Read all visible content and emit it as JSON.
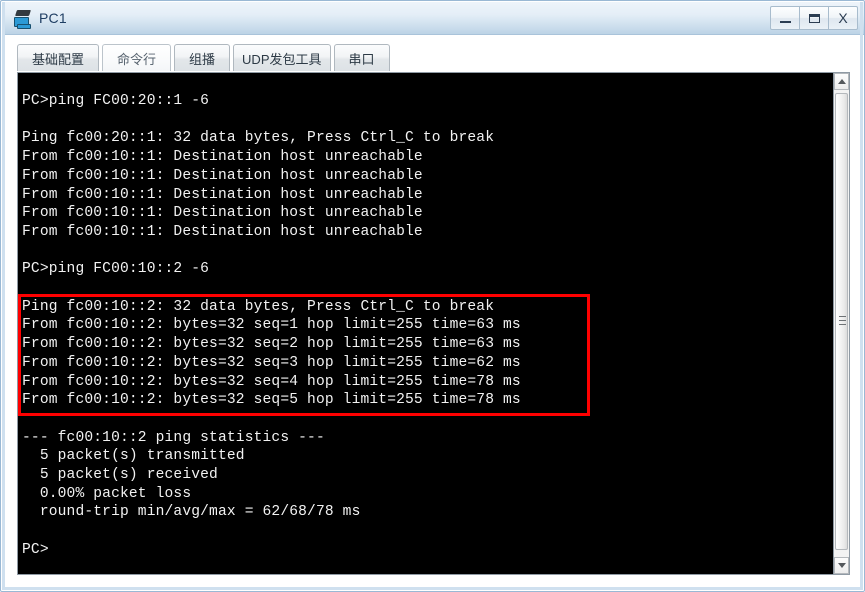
{
  "window": {
    "title": "PC1",
    "icon": "pc-device-icon",
    "buttons": {
      "minimize": "minimize-button",
      "maximize": "maximize-button",
      "close": "X"
    }
  },
  "tabs": [
    {
      "label": "基础配置",
      "active": false
    },
    {
      "label": "命令行",
      "active": true
    },
    {
      "label": "组播",
      "active": false
    },
    {
      "label": "UDP发包工具",
      "active": false
    },
    {
      "label": "串口",
      "active": false
    }
  ],
  "terminal": {
    "background_color": "#000000",
    "text_color": "#f2f2f2",
    "content": "PC>ping FC00:20::1 -6\n\nPing fc00:20::1: 32 data bytes, Press Ctrl_C to break\nFrom fc00:10::1: Destination host unreachable\nFrom fc00:10::1: Destination host unreachable\nFrom fc00:10::1: Destination host unreachable\nFrom fc00:10::1: Destination host unreachable\nFrom fc00:10::1: Destination host unreachable\n\nPC>ping FC00:10::2 -6\n\nPing fc00:10::2: 32 data bytes, Press Ctrl_C to break\nFrom fc00:10::2: bytes=32 seq=1 hop limit=255 time=63 ms\nFrom fc00:10::2: bytes=32 seq=2 hop limit=255 time=63 ms\nFrom fc00:10::2: bytes=32 seq=3 hop limit=255 time=62 ms\nFrom fc00:10::2: bytes=32 seq=4 hop limit=255 time=78 ms\nFrom fc00:10::2: bytes=32 seq=5 hop limit=255 time=78 ms\n\n--- fc00:10::2 ping statistics ---\n  5 packet(s) transmitted\n  5 packet(s) received\n  0.00% packet loss\n  round-trip min/avg/max = 62/68/78 ms\n\nPC>"
  },
  "annotation": {
    "highlight_color": "#ff0000",
    "highlighted_lines": [
      "Ping fc00:10::2: 32 data bytes, Press Ctrl_C to break",
      "From fc00:10::2: bytes=32 seq=1 hop limit=255 time=63 ms",
      "From fc00:10::2: bytes=32 seq=2 hop limit=255 time=63 ms",
      "From fc00:10::2: bytes=32 seq=3 hop limit=255 time=62 ms",
      "From fc00:10::2: bytes=32 seq=4 hop limit=255 time=78 ms",
      "From fc00:10::2: bytes=32 seq=5 hop limit=255 time=78 ms"
    ]
  },
  "scrollbar": {
    "up_arrow": "scroll-up-arrow",
    "down_arrow": "scroll-down-arrow",
    "thumb": "scroll-thumb"
  }
}
